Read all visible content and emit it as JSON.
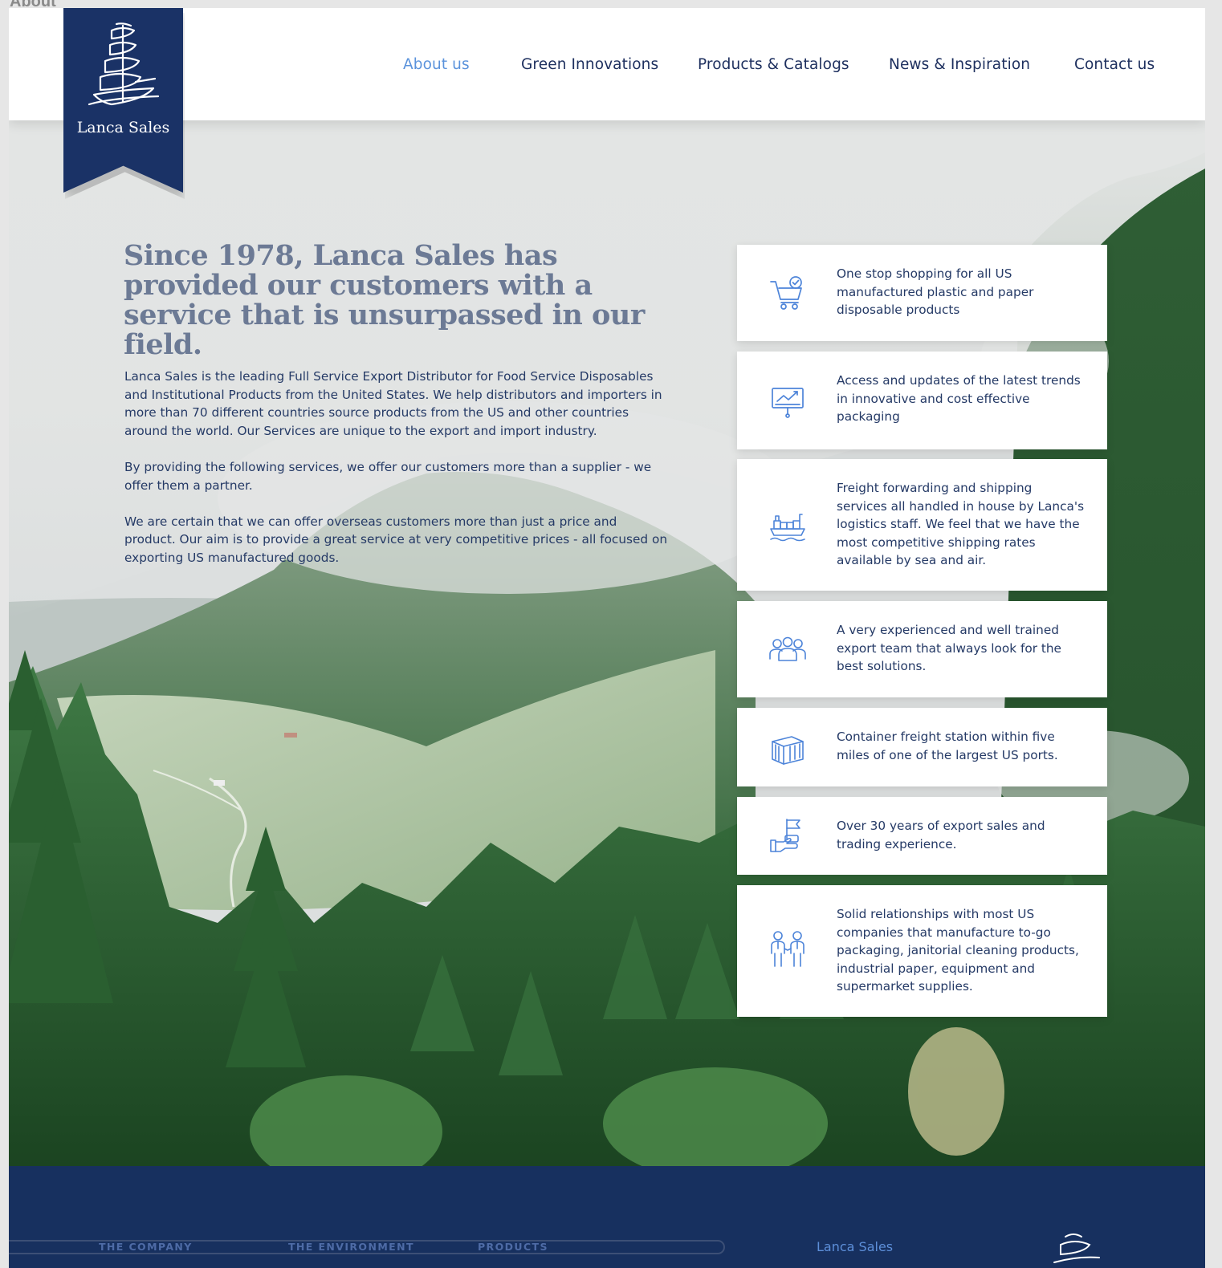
{
  "canvas": {
    "label": "About"
  },
  "brand": {
    "name": "Lanca Sales"
  },
  "nav": [
    {
      "label": "About us",
      "active": true
    },
    {
      "label": "Green Innovations",
      "active": false
    },
    {
      "label": "Products & Catalogs",
      "active": false
    },
    {
      "label": "News & Inspiration",
      "active": false
    },
    {
      "label": "Contact us",
      "active": false
    }
  ],
  "hero": {
    "headline": "Since 1978, Lanca Sales has provided our customers with a service that is unsurpassed in our field.",
    "paragraphs": [
      "Lanca Sales is the leading Full Service Export Distributor for Food Service Disposables and Institutional Products from the United States. We help distributors and importers in more than 70 different countries source products from the US and other countries around the world. Our Services are unique to the export and import industry.",
      "By providing the following services, we offer our customers more than a supplier - we offer them a partner.",
      "We are certain that we can offer overseas customers more than just a price and product. Our aim is to provide a great service at very competitive prices - all focused on exporting US manufactured goods."
    ]
  },
  "features": [
    {
      "icon": "shopping-cart-check-icon",
      "text": "One stop shopping for all US manufactured plastic and paper disposable products"
    },
    {
      "icon": "presentation-chart-icon",
      "text": "Access and updates of the latest trends in innovative and cost effective packaging"
    },
    {
      "icon": "cargo-ship-icon",
      "text": "Freight forwarding and shipping services all handled in house by Lanca's logistics staff. We feel that we have the most competitive shipping rates available by sea and air."
    },
    {
      "icon": "team-icon",
      "text": "A very experienced and well trained export team that always look for the best solutions."
    },
    {
      "icon": "shipping-container-icon",
      "text": "Container freight station within five miles of one of the largest US ports."
    },
    {
      "icon": "flag-handshake-icon",
      "text": "Over 30 years of export sales and trading experience."
    },
    {
      "icon": "business-partners-icon",
      "text": "Solid relationships with most US companies that manufacture to-go packaging, janitorial cleaning products, industrial paper, equipment and supermarket supplies."
    }
  ],
  "footer": {
    "links": [
      "THE COMPANY",
      "THE ENVIRONMENT",
      "PRODUCTS"
    ],
    "brand": "Lanca Sales"
  },
  "colors": {
    "navy": "#1a3266",
    "accent_blue": "#5b93dc",
    "text": "#253a66",
    "headline": "#6c7a95"
  }
}
